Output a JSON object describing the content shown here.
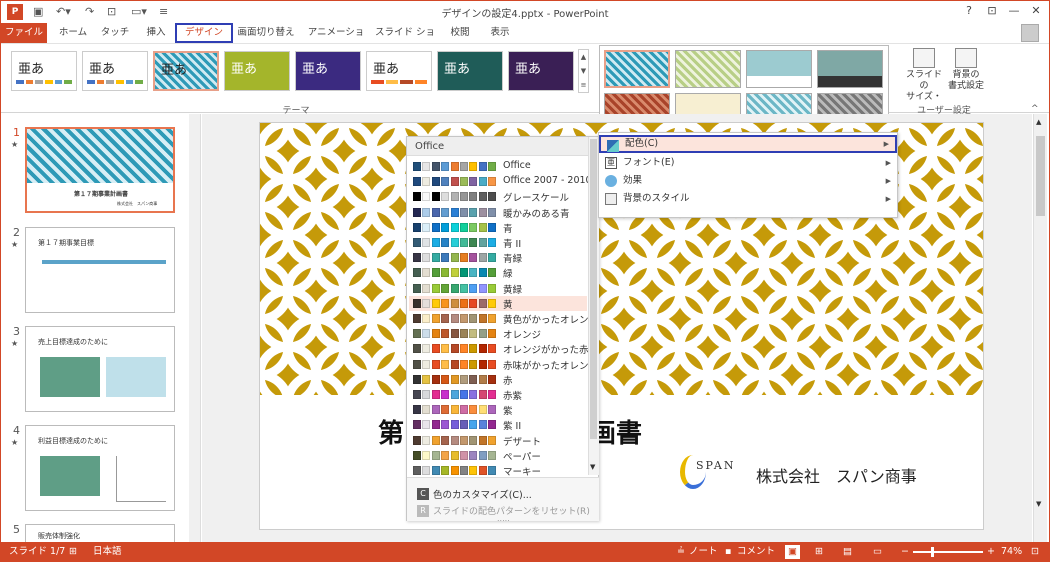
{
  "app": {
    "title": "デザインの設定4.pptx - PowerPoint"
  },
  "tabs": [
    {
      "label": "ファイル"
    },
    {
      "label": "ホーム"
    },
    {
      "label": "タッチ"
    },
    {
      "label": "挿入"
    },
    {
      "label": "デザイン"
    },
    {
      "label": "画面切り替え"
    },
    {
      "label": "アニメーション"
    },
    {
      "label": "スライド ショー"
    },
    {
      "label": "校閲"
    },
    {
      "label": "表示"
    }
  ],
  "ribbon": {
    "theme_text": "亜あ",
    "group_theme": "テーマ",
    "slide_size": "スライドの\nサイズ・",
    "background_format": "背景の\n書式設定",
    "group_user": "ユーザー設定",
    "help": "?"
  },
  "slides": [
    {
      "num": "1",
      "title": "第１７期事業計画書",
      "company": "株式会社　スパン商事"
    },
    {
      "num": "2",
      "title": "第１７期事業目標"
    },
    {
      "num": "3",
      "title": "売上目標達成のために"
    },
    {
      "num": "4",
      "title": "利益目標達成のために"
    },
    {
      "num": "5",
      "title": "販売体制強化"
    }
  ],
  "slide": {
    "title_left": "第",
    "title_right": "画書",
    "logo_text": "SPAN",
    "company": "株式会社　スパン商事"
  },
  "palette": {
    "header": "Office",
    "selected_index": 9,
    "items": [
      {
        "label": "Office",
        "colors": [
          "#1f4e79",
          "#e7e6e6",
          "#44546a",
          "#5b9bd5",
          "#ed7d31",
          "#a5a5a5",
          "#ffc000",
          "#4472c4",
          "#70ad47"
        ]
      },
      {
        "label": "Office 2007 - 2010",
        "colors": [
          "#1f497d",
          "#eeece1",
          "#1f497d",
          "#4f81bd",
          "#c0504d",
          "#9bbb59",
          "#8064a2",
          "#4bacc6",
          "#f79646"
        ]
      },
      {
        "label": "グレースケール",
        "colors": [
          "#000000",
          "#f8f8f8",
          "#000000",
          "#dddddd",
          "#b2b2b2",
          "#969696",
          "#808080",
          "#5f5f5f",
          "#4d4d4d"
        ]
      },
      {
        "label": "暖かみのある青",
        "colors": [
          "#242852",
          "#acccea",
          "#4a66ac",
          "#629dd1",
          "#297fd5",
          "#7f8fa9",
          "#5aa2ae",
          "#9d90a0",
          "#7f8fa9"
        ]
      },
      {
        "label": "青",
        "colors": [
          "#17406d",
          "#dbeff9",
          "#0f6fc6",
          "#009dd9",
          "#0bd0d9",
          "#10cf9b",
          "#7cca62",
          "#a5c249",
          "#0f6fc6"
        ]
      },
      {
        "label": "青 II",
        "colors": [
          "#335b74",
          "#dfe3e5",
          "#1cade4",
          "#2683c6",
          "#27ced7",
          "#42ba97",
          "#3e8853",
          "#62a39f",
          "#1cade4"
        ]
      },
      {
        "label": "青緑",
        "colors": [
          "#373545",
          "#dedede",
          "#34aba2",
          "#3d7abb",
          "#94b64e",
          "#e67e22",
          "#a4539d",
          "#9da6a5",
          "#34aba2"
        ]
      },
      {
        "label": "緑",
        "colors": [
          "#455f51",
          "#e3ded1",
          "#549e39",
          "#8ab833",
          "#c0cf3a",
          "#029676",
          "#4ab5c4",
          "#0989b1",
          "#549e39"
        ]
      },
      {
        "label": "黄緑",
        "colors": [
          "#455f51",
          "#e3ded1",
          "#99cb38",
          "#63a537",
          "#37a76f",
          "#44c1a3",
          "#4e9ff3",
          "#9295ff",
          "#99cb38"
        ]
      },
      {
        "label": "黄",
        "colors": [
          "#39302a",
          "#e5dedb",
          "#ffca08",
          "#f8931d",
          "#ce8d3e",
          "#ec7016",
          "#e64823",
          "#9c6a6a",
          "#ffca08"
        ]
      },
      {
        "label": "黄色がかったオレンジ",
        "colors": [
          "#4e3b30",
          "#fbeec9",
          "#f0a22e",
          "#a5644e",
          "#b58b80",
          "#c3986d",
          "#a19574",
          "#c17529",
          "#f0a22e"
        ]
      },
      {
        "label": "オレンジ",
        "colors": [
          "#637052",
          "#ccddea",
          "#e48312",
          "#bd582c",
          "#865640",
          "#9b8357",
          "#c2bc80",
          "#94a088",
          "#e48312"
        ]
      },
      {
        "label": "オレンジがかった赤",
        "colors": [
          "#505046",
          "#eeece1",
          "#e84c22",
          "#ffbd47",
          "#b64926",
          "#ff8427",
          "#cc9900",
          "#b22600",
          "#e84c22"
        ]
      },
      {
        "label": "赤味がかったオレンジ",
        "colors": [
          "#505046",
          "#eeece1",
          "#e84c22",
          "#ffbd47",
          "#b64926",
          "#ff8427",
          "#cc9900",
          "#b22600",
          "#e84c22"
        ]
      },
      {
        "label": "赤",
        "colors": [
          "#323232",
          "#e5c243",
          "#a5300f",
          "#d55816",
          "#e19825",
          "#b19c7d",
          "#7f5f52",
          "#b27d49",
          "#a5300f"
        ]
      },
      {
        "label": "赤紫",
        "colors": [
          "#454551",
          "#d8d9dc",
          "#e32d91",
          "#c830cc",
          "#4ea6dc",
          "#4775e7",
          "#8971e1",
          "#d54773",
          "#e32d91"
        ]
      },
      {
        "label": "紫",
        "colors": [
          "#373545",
          "#e3ded1",
          "#ac66bb",
          "#de6c36",
          "#f9b639",
          "#cf6da4",
          "#fa8d3d",
          "#ffde75",
          "#ac66bb"
        ]
      },
      {
        "label": "紫 II",
        "colors": [
          "#632e62",
          "#eae5eb",
          "#92278f",
          "#9b57d3",
          "#755dd9",
          "#665eb8",
          "#45a5ed",
          "#5982db",
          "#92278f"
        ]
      },
      {
        "label": "デザート",
        "colors": [
          "#4e3b30",
          "#eeece1",
          "#f0a22e",
          "#a5644e",
          "#b58b80",
          "#c3986d",
          "#a19574",
          "#c17529",
          "#f0a22e"
        ]
      },
      {
        "label": "ペーパー",
        "colors": [
          "#444d26",
          "#fefac9",
          "#a5b592",
          "#f3a447",
          "#e7bc29",
          "#d092a7",
          "#9c85c0",
          "#809ec2",
          "#a5b592"
        ]
      },
      {
        "label": "マーキー",
        "colors": [
          "#5e5e5e",
          "#ddddde",
          "#418ab3",
          "#a6b727",
          "#f69200",
          "#838383",
          "#fec306",
          "#df5327",
          "#418ab3"
        ]
      }
    ],
    "customize": "色のカスタマイズ(C)...",
    "reset": "スライドの配色パターンをリセット(R)",
    "dots": "....."
  },
  "menu": {
    "items": [
      {
        "label": "配色(C)"
      },
      {
        "label": "フォント(E)"
      },
      {
        "label": "効果"
      },
      {
        "label": "背景のスタイル"
      }
    ]
  },
  "status": {
    "slide": "スライド 1/7",
    "lang": "日本語",
    "notes": "ノート",
    "comments": "コメント",
    "zoom": "74%"
  },
  "colors": {
    "accent": "#d24726",
    "highlight": "#2f3eb4",
    "gold": "#c59a09"
  }
}
